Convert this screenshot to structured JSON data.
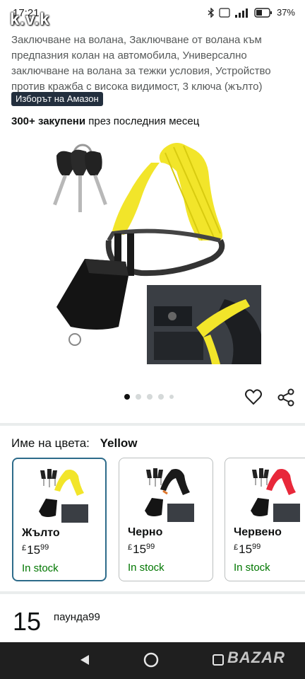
{
  "status_bar": {
    "time": "17:21",
    "overlay_text": "k.v.k",
    "battery": "37%"
  },
  "product": {
    "title": "Заключване на волана, Заключване от волана към предпазния колан на автомобила, Универсално заключване на волана за тежки условия, Устройство против кражба с висока видимост, 3 ключа (жълто)",
    "choice_badge": "Изборът на Амазон",
    "bought_count": "300+ закупени",
    "bought_suffix": "през последния месец"
  },
  "carousel": {
    "total": 5,
    "active": 0
  },
  "color": {
    "label": "Име на цвета:",
    "selected": "Yellow",
    "options": [
      {
        "name": "Жълто",
        "currency": "£",
        "price_whole": "15",
        "price_fraction": "99",
        "stock": "In stock",
        "strap_color": "#f2e52a"
      },
      {
        "name": "Черно",
        "currency": "£",
        "price_whole": "15",
        "price_fraction": "99",
        "stock": "In stock",
        "strap_color": "#1a1a1a"
      },
      {
        "name": "Червено",
        "currency": "£",
        "price_whole": "15",
        "price_fraction": "99",
        "stock": "In stock",
        "strap_color": "#e8283a"
      }
    ]
  },
  "price": {
    "whole": "15",
    "unit_fraction": "паунда99"
  },
  "watermark": "BAZAR",
  "colors": {
    "accent": "#2d6b8a",
    "stock": "#007600",
    "badge": "#232f3e",
    "strap": "#f2e52a"
  },
  "icons": [
    "heart-icon",
    "share-icon",
    "back-icon",
    "home-icon",
    "recent-apps-icon",
    "wifi-icon",
    "signal-icon",
    "battery-icon",
    "bluetooth-icon"
  ]
}
